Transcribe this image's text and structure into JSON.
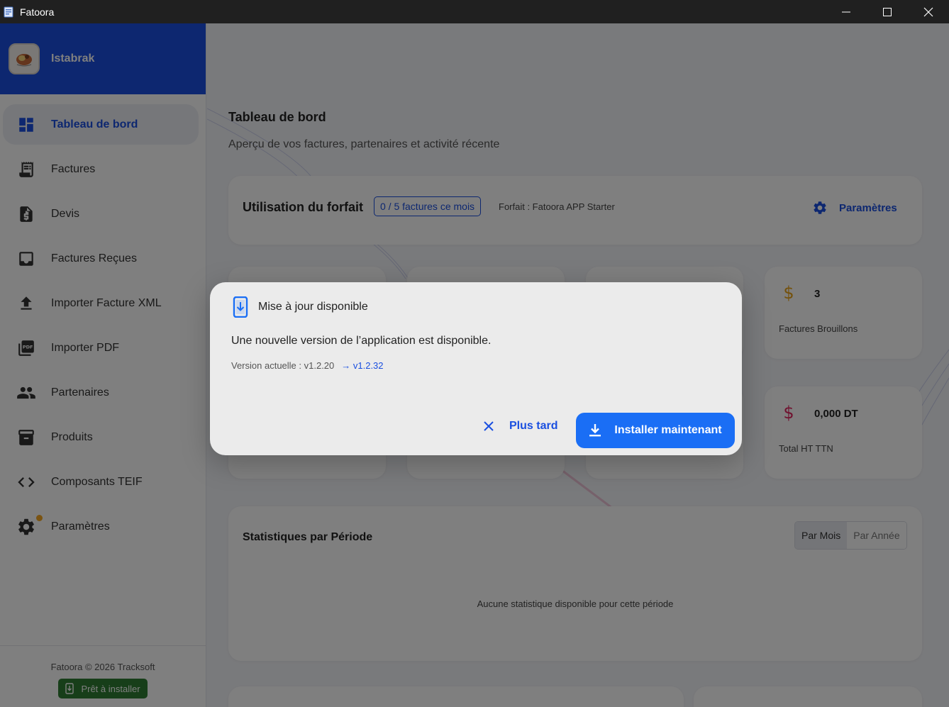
{
  "window": {
    "title": "Fatoora",
    "controls": [
      "minimize-icon",
      "maximize-icon",
      "close-icon"
    ]
  },
  "sidebar": {
    "company_name": "Istabrak",
    "items": [
      {
        "label": "Tableau de bord",
        "icon": "dashboard-icon",
        "active": true
      },
      {
        "label": "Factures",
        "icon": "invoice-icon"
      },
      {
        "label": "Devis",
        "icon": "quote-icon"
      },
      {
        "label": "Factures Reçues",
        "icon": "inbox-icon"
      },
      {
        "label": "Importer Facture XML",
        "icon": "upload-icon"
      },
      {
        "label": "Importer PDF",
        "icon": "pdf-icon"
      },
      {
        "label": "Partenaires",
        "icon": "people-icon"
      },
      {
        "label": "Produits",
        "icon": "archive-icon"
      },
      {
        "label": "Composants TEIF",
        "icon": "code-icon"
      },
      {
        "label": "Paramètres",
        "icon": "gear-icon",
        "badge": true
      }
    ],
    "footer": {
      "copyright": "Fatoora © 2026 Tracksoft",
      "ready_label": "Prêt à installer"
    }
  },
  "main": {
    "title": "Tableau de bord",
    "subtitle": "Aperçu de vos factures, partenaires et activité récente",
    "usage": {
      "title": "Utilisation du forfait",
      "pill": "0 / 5 factures ce mois",
      "plan": "Forfait : Fatoora APP Starter",
      "settings_label": "Paramètres"
    },
    "stats": [
      {
        "value": "3",
        "label": "Factures Brouillons",
        "icon": "dollar-icon",
        "icon_color": "#e8a317"
      },
      {
        "value": "0,000 DT",
        "label": "Total HT TTN",
        "icon": "dollar-icon",
        "icon_color": "#e0245e"
      }
    ],
    "period": {
      "title": "Statistiques par Période",
      "options": [
        "Par Mois",
        "Par Année"
      ],
      "selected": "Par Mois",
      "empty": "Aucune statistique disponible pour cette période"
    }
  },
  "dialog": {
    "title": "Mise à jour disponible",
    "message": "Une nouvelle version de l’application est disponible.",
    "current_version": "Version actuelle : v1.2.20",
    "new_version": "→ v1.2.32",
    "later_label": "Plus tard",
    "install_label": "Installer maintenant"
  },
  "colors": {
    "accent": "#1a4fe0",
    "button_blue": "#1a6ef5",
    "ready_green": "#2e7d32",
    "badge_orange": "#f5a623"
  }
}
